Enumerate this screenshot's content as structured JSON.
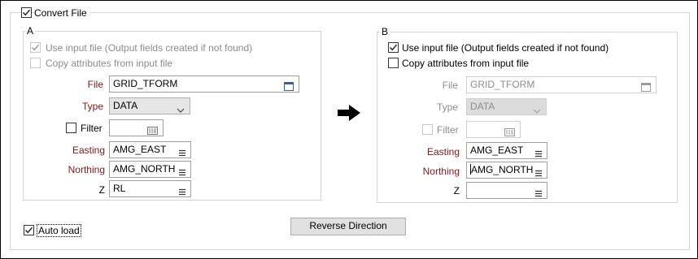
{
  "convert_file": {
    "label": "Convert File",
    "checked": true
  },
  "panel_a": {
    "title": "A",
    "use_input_file": {
      "label": "Use input file (Output fields created if not found)",
      "checked": true,
      "disabled": true
    },
    "copy_attributes": {
      "label": "Copy attributes from input file",
      "checked": false,
      "disabled": true
    },
    "file": {
      "label": "File",
      "value": "GRID_TFORM"
    },
    "type": {
      "label": "Type",
      "value": "DATA"
    },
    "filter": {
      "label": "Filter",
      "checked": false,
      "value": ""
    },
    "easting": {
      "label": "Easting",
      "value": "AMG_EAST"
    },
    "northing": {
      "label": "Northing",
      "value": "AMG_NORTH"
    },
    "z": {
      "label": "Z",
      "value": "RL"
    }
  },
  "panel_b": {
    "title": "B",
    "use_input_file": {
      "label": "Use input file (Output fields created if not found)",
      "checked": true,
      "disabled": false
    },
    "copy_attributes": {
      "label": "Copy attributes from input file",
      "checked": false,
      "disabled": false
    },
    "file": {
      "label": "File",
      "value": "GRID_TFORM"
    },
    "type": {
      "label": "Type",
      "value": "DATA"
    },
    "filter": {
      "label": "Filter",
      "checked": false,
      "value": ""
    },
    "easting": {
      "label": "Easting",
      "value": "AMG_EAST"
    },
    "northing": {
      "label": "Northing",
      "value": "AMG_NORTH"
    },
    "z": {
      "label": "Z",
      "value": ""
    }
  },
  "arrow_icon": "arrow-right-icon",
  "auto_load": {
    "label": "Auto load",
    "checked": true
  },
  "reverse_button": {
    "label": "Reverse Direction"
  },
  "colors": {
    "required_label": "#7a1a1a",
    "disabled_text": "#8c8c8c"
  }
}
